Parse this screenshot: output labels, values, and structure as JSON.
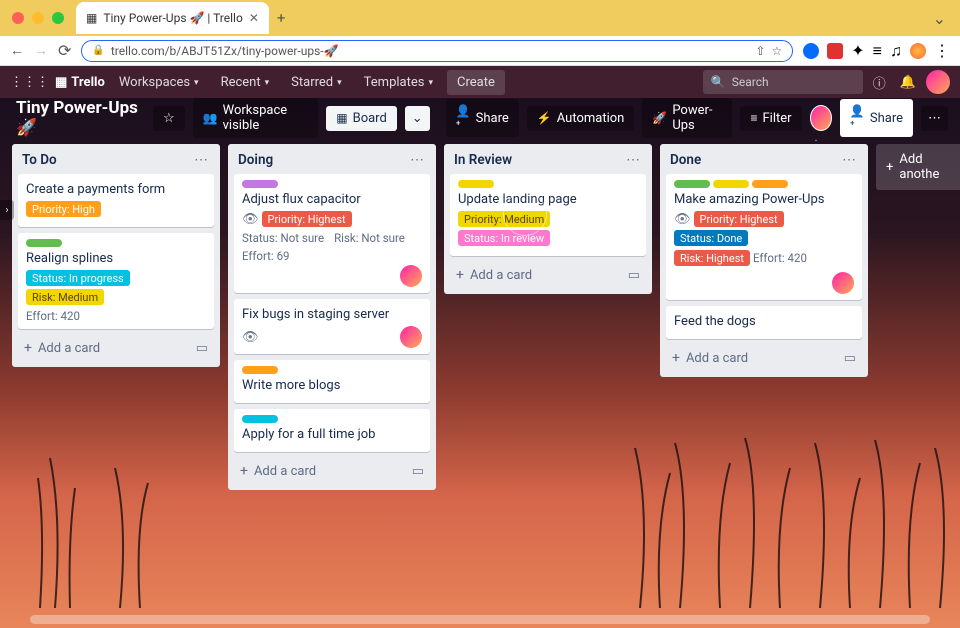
{
  "browser": {
    "tab_title": "Tiny Power-Ups 🚀 | Trello",
    "url": "trello.com/b/ABJT51Zx/tiny-power-ups-🚀"
  },
  "trello_header": {
    "logo": "Trello",
    "workspaces": "Workspaces",
    "recent": "Recent",
    "starred": "Starred",
    "templates": "Templates",
    "create": "Create",
    "search_placeholder": "Search"
  },
  "board_header": {
    "title": "Tiny Power-Ups 🚀",
    "workspace_visible": "Workspace visible",
    "board": "Board",
    "share_left": "Share",
    "automation": "Automation",
    "powerups": "Power-Ups",
    "filter": "Filter",
    "share_right": "Share"
  },
  "lists": [
    {
      "title": "To Do",
      "cards": [
        {
          "stripes": [],
          "title": "Create a payments form",
          "labels": [
            {
              "text": "Priority: High",
              "cls": "t-orange"
            }
          ],
          "badges": [],
          "avatar": false
        },
        {
          "stripes": [
            {
              "cls": "c-green"
            }
          ],
          "title": "Realign splines",
          "labels": [
            {
              "text": "Status: In progress",
              "cls": "t-sky"
            },
            {
              "text": "Risk: Medium",
              "cls": "t-yellow"
            }
          ],
          "badges": [
            {
              "text": "Effort: 420"
            }
          ],
          "avatar": false
        }
      ],
      "add": "Add a card"
    },
    {
      "title": "Doing",
      "cards": [
        {
          "stripes": [
            {
              "cls": "c-purple"
            }
          ],
          "title": "Adjust flux capacitor",
          "labels_row": [
            {
              "icon": "eye"
            },
            {
              "text": "Priority: Highest",
              "cls": "t-red"
            }
          ],
          "badges": [
            {
              "text": "Status: Not sure"
            },
            {
              "text": "Risk: Not sure"
            }
          ],
          "badges2": [
            {
              "text": "Effort: 69"
            }
          ],
          "avatar": true
        },
        {
          "stripes": [],
          "title": "Fix bugs in staging server",
          "labels_row": [
            {
              "icon": "eye"
            }
          ],
          "badges": [],
          "avatar": true
        },
        {
          "stripes": [
            {
              "cls": "c-orange"
            }
          ],
          "title": "Write more blogs",
          "badges": [],
          "avatar": false
        },
        {
          "stripes": [
            {
              "cls": "c-sky"
            }
          ],
          "title": "Apply for a full time job",
          "badges": [],
          "avatar": false
        }
      ],
      "add": "Add a card"
    },
    {
      "title": "In Review",
      "cards": [
        {
          "stripes": [
            {
              "cls": "c-yellow"
            }
          ],
          "title": "Update landing page",
          "labels": [
            {
              "text": "Priority: Medium",
              "cls": "t-yellow"
            },
            {
              "text": "Status: In review",
              "cls": "t-pink"
            }
          ],
          "badges": [],
          "avatar": false
        }
      ],
      "add": "Add a card"
    },
    {
      "title": "Done",
      "cards": [
        {
          "stripes": [
            {
              "cls": "c-green"
            },
            {
              "cls": "c-yellow"
            },
            {
              "cls": "c-orange"
            }
          ],
          "title": "Make amazing Power-Ups",
          "labels_row": [
            {
              "icon": "eye"
            },
            {
              "text": "Priority: Highest",
              "cls": "t-red"
            },
            {
              "text": "Status: Done",
              "cls": "t-blue"
            }
          ],
          "labels2": [
            {
              "text": "Risk: Highest",
              "cls": "t-red"
            }
          ],
          "badges_inline": [
            {
              "text": "Effort: 420"
            }
          ],
          "avatar": true
        },
        {
          "stripes": [],
          "title": "Feed the dogs",
          "badges": [],
          "avatar": false
        }
      ],
      "add": "Add a card"
    }
  ],
  "add_another_list": "Add anothe"
}
